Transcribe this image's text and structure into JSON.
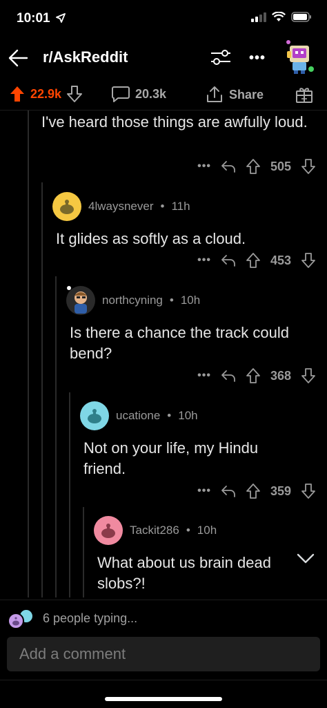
{
  "status": {
    "time": "10:01"
  },
  "header": {
    "title": "r/AskReddit"
  },
  "post_actions": {
    "upvotes": "22.9k",
    "comments": "20.3k",
    "share": "Share"
  },
  "comments": [
    {
      "body": "I've heard those things are awfully loud.",
      "score": "505",
      "avatar_color": "#000000"
    },
    {
      "user": "4lwaysnever",
      "time": "11h",
      "body": "It glides as softly as a cloud.",
      "score": "453",
      "avatar_color": "#f5c842"
    },
    {
      "user": "northcyning",
      "time": "10h",
      "body": "Is there a chance the track could bend?",
      "score": "368",
      "avatar_color": "#3a4a6a"
    },
    {
      "user": "ucatione",
      "time": "10h",
      "body": "Not on your life, my Hindu friend.",
      "score": "359",
      "avatar_color": "#7fd7e6"
    },
    {
      "user": "Tackit286",
      "time": "10h",
      "body": "What about us brain dead slobs?!",
      "avatar_color": "#f08aa0"
    }
  ],
  "typing": {
    "text": "6 people typing..."
  },
  "composer": {
    "placeholder": "Add a comment"
  },
  "colors": {
    "accent": "#ff4500",
    "background": "#000000",
    "muted": "#9a9a9a"
  }
}
